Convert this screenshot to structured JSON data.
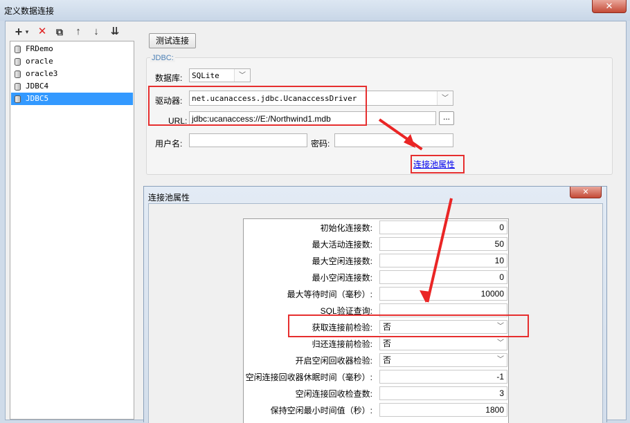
{
  "window": {
    "title": "定义数据连接",
    "close_glyph": "✕"
  },
  "toolbar": {
    "add": "+",
    "add_dropdown": "▾",
    "delete": "✕",
    "copy": "⧉",
    "move_up": "↑",
    "move_down": "↓",
    "sort": "⇊"
  },
  "connections": [
    "FRDemo",
    "oracle",
    "oracle3",
    "JDBC4",
    "JDBC5"
  ],
  "selected_connection": "JDBC5",
  "form": {
    "test_button": "测试连接",
    "group_label": "JDBC:",
    "database_label": "数据库:",
    "database_value": "SQLite",
    "driver_label": "驱动器:",
    "driver_value": "net.ucanaccess.jdbc.UcanaccessDriver",
    "url_label": "URL:",
    "url_value": "jdbc:ucanaccess://E:/Northwind1.mdb",
    "browse": "...",
    "username_label": "用户名:",
    "username_value": "",
    "password_label": "密码:",
    "password_value": "",
    "pool_link": "连接池属性",
    "dropdown_arrow": "﹀"
  },
  "pool_dialog": {
    "title": "连接池属性",
    "close_glyph": "✕",
    "rows": [
      {
        "label": "初始化连接数:",
        "value": "0"
      },
      {
        "label": "最大活动连接数:",
        "value": "50"
      },
      {
        "label": "最大空闲连接数:",
        "value": "10"
      },
      {
        "label": "最小空闲连接数:",
        "value": "0"
      },
      {
        "label": "最大等待时间（毫秒）:",
        "value": "10000"
      },
      {
        "label": "SQL验证查询:",
        "value": ""
      },
      {
        "label": "获取连接前检验:",
        "value": "否"
      },
      {
        "label": "归还连接前检验:",
        "value": "否"
      },
      {
        "label": "开启空闲回收器检验:",
        "value": "否"
      },
      {
        "label": "空闲连接回收器休眠时间（毫秒）:",
        "value": "-1"
      },
      {
        "label": "空闲连接回收检查数:",
        "value": "3"
      },
      {
        "label": "保持空闲最小时间值（秒）:",
        "value": "1800"
      }
    ]
  },
  "colors": {
    "highlight_box": "#e62e2e",
    "selection": "#3399ff",
    "link": "#0000ee"
  }
}
